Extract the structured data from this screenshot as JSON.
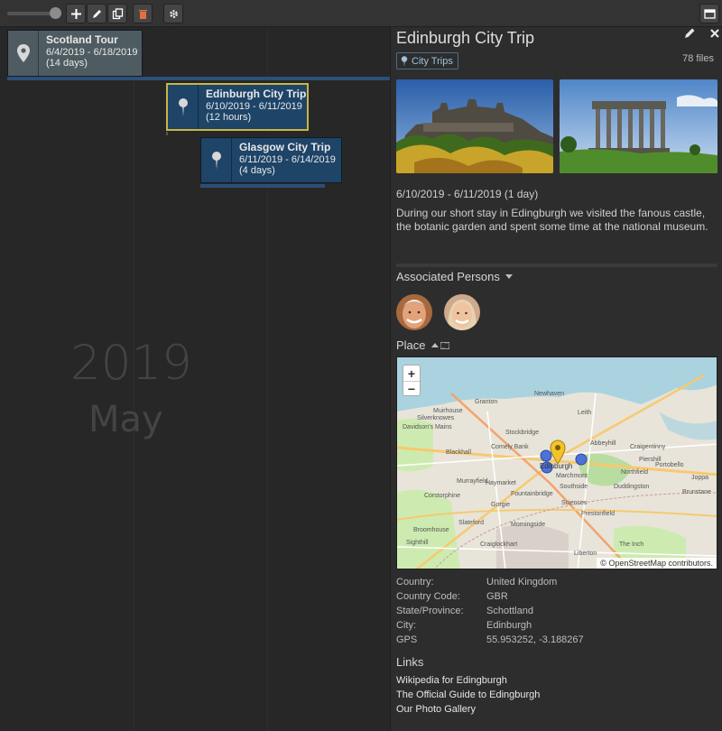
{
  "toolbar": {
    "icons": [
      "add-icon",
      "pencil-icon",
      "copy-icon",
      "trash-icon",
      "gear-icon",
      "panel-icon"
    ],
    "trash_color": "#e07040"
  },
  "timeline": {
    "year": "2019",
    "month": "May",
    "events": [
      {
        "title": "Scotland Tour",
        "dates": "6/4/2019 - 6/18/2019",
        "duration": "(14 days)"
      },
      {
        "title": "Edinburgh City Trip",
        "dates": "6/10/2019 - 6/11/2019",
        "duration": "(12 hours)"
      },
      {
        "title": "Glasgow City Trip",
        "dates": "6/11/2019 - 6/14/2019",
        "duration": "(4 days)"
      }
    ]
  },
  "detail": {
    "title": "Edinburgh City Trip",
    "category": "City Trips",
    "files": "78 files",
    "date_range": "6/10/2019 - 6/11/2019 (1 day)",
    "description": "During our short stay in Edingburgh we visited the fanous castle, the botanic garden and spent some time at the national museum.",
    "persons_heading": "Associated Persons",
    "place_heading": "Place",
    "map": {
      "attribution": "© OpenStreetMap contributors.",
      "zoom_in": "+",
      "zoom_out": "−",
      "labels": [
        "Newhaven",
        "Leith",
        "Granton",
        "Silverknowes",
        "Davidson's Mains",
        "Blackhall",
        "Comely Bank",
        "Craigentinny",
        "Portobello",
        "Edinburgh",
        "Corstorphine",
        "Haymarket",
        "Southside",
        "Duddingston",
        "Murrayfield",
        "Gorgie",
        "Sciences",
        "Slateford",
        "Morningside",
        "Prestonfield",
        "Broomhouse",
        "Sighthill",
        "Northfield",
        "Joppa",
        "Brunstane",
        "Piershill",
        "Fountainbridge",
        "The Inch",
        "Abbeyhill",
        "Muirhouse",
        "Marchmont",
        "Stockbridge",
        "Craiglockhart",
        "Liberton"
      ]
    },
    "properties": [
      {
        "key": "Country:",
        "value": "United Kingdom"
      },
      {
        "key": "Country Code:",
        "value": "GBR"
      },
      {
        "key": "State/Province:",
        "value": "Schottland"
      },
      {
        "key": "City:",
        "value": "Edinburgh"
      },
      {
        "key": "GPS",
        "value": "55.953252, -3.188267"
      }
    ],
    "links_heading": "Links",
    "links": [
      "Wikipedia for Edingburgh",
      "The Official Guide to Edingburgh",
      "Our Photo Gallery"
    ]
  },
  "colors": {
    "accent_blue": "#1e4468",
    "selected_border": "#c9b541",
    "tag_blue": "#9fc3de"
  }
}
